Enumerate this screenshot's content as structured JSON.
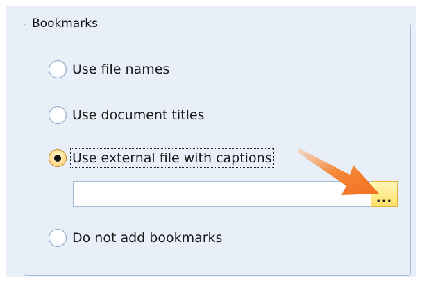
{
  "group": {
    "title": "Bookmarks"
  },
  "options": [
    {
      "label": "Use file names",
      "checked": false
    },
    {
      "label": "Use document titles",
      "checked": false
    },
    {
      "label": "Use external file with captions",
      "checked": true
    },
    {
      "label": "Do not add bookmarks",
      "checked": false
    }
  ],
  "file_input": {
    "value": "",
    "browse_label": "..."
  },
  "colors": {
    "panel_background": "#e9eff8",
    "border": "#a9bedb",
    "browse_button": "#ffe169",
    "arrow": "#f47b2a"
  },
  "icons": {
    "annotation": "arrow-pointing-icon"
  }
}
